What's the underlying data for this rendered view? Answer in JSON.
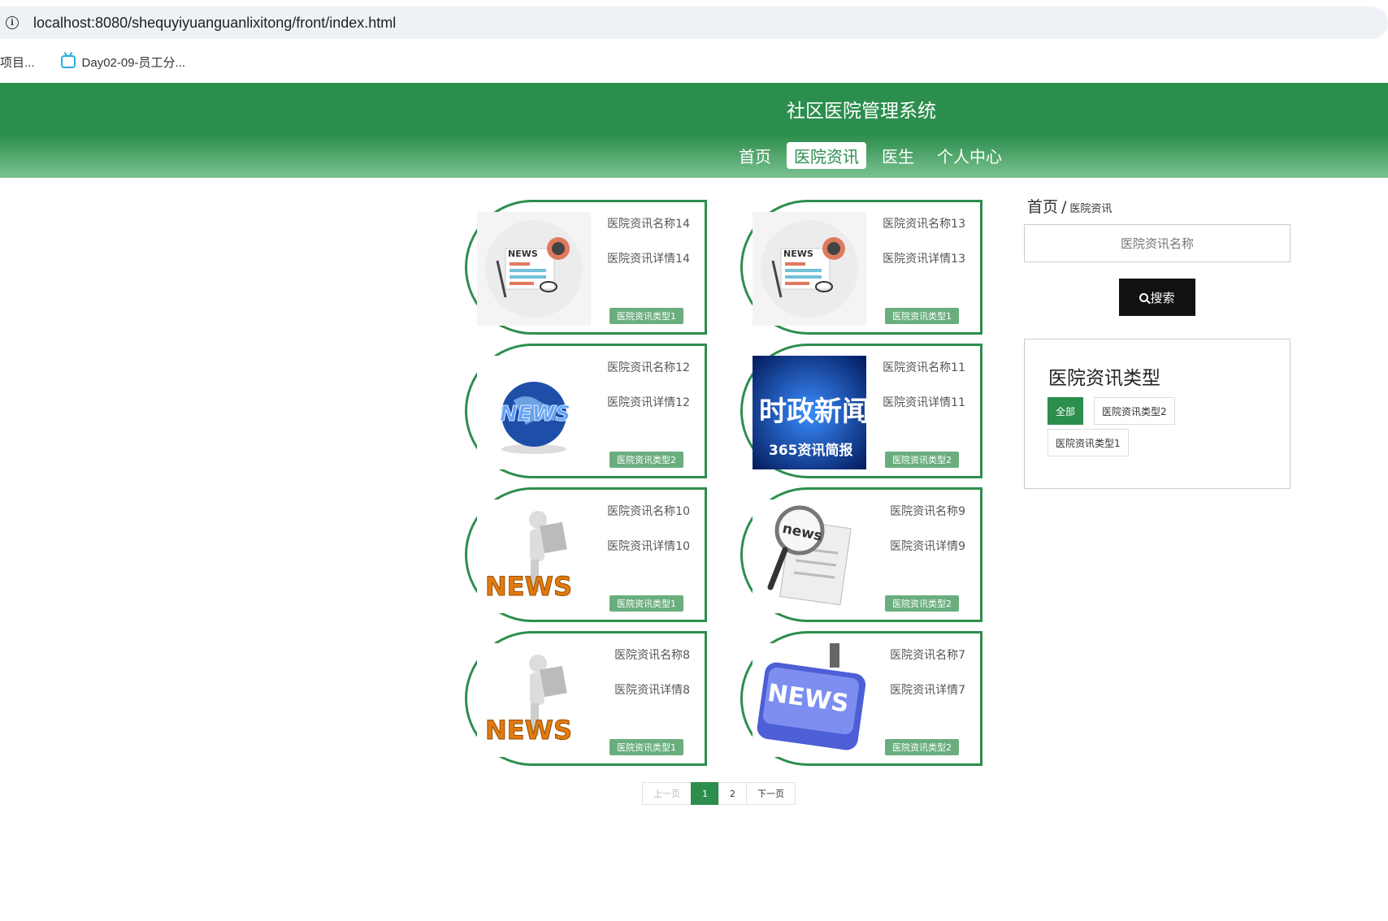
{
  "browser": {
    "url_host": "localhost",
    "url_rest": ":8080/shequyiyuanguanlixitong/front/index.html",
    "bookmarks": [
      {
        "label": "项目..."
      },
      {
        "label": "Day02-09-员工分..."
      }
    ]
  },
  "header": {
    "title": "社区医院管理系统",
    "nav": [
      {
        "label": "首页"
      },
      {
        "label": "医院资讯",
        "active": true
      },
      {
        "label": "医生"
      },
      {
        "label": "个人中心"
      }
    ]
  },
  "cards": [
    {
      "name": "医院资讯名称14",
      "detail": "医院资讯详情14",
      "type": "医院资讯类型1",
      "image": "news-paper-icon"
    },
    {
      "name": "医院资讯名称13",
      "detail": "医院资讯详情13",
      "type": "医院资讯类型1",
      "image": "news-paper-icon"
    },
    {
      "name": "医院资讯名称12",
      "detail": "医院资讯详情12",
      "type": "医院资讯类型2",
      "image": "news-globe-icon"
    },
    {
      "name": "医院资讯名称11",
      "detail": "医院资讯详情11",
      "type": "医院资讯类型2",
      "image": "political-news-banner"
    },
    {
      "name": "医院资讯名称10",
      "detail": "医院资讯详情10",
      "type": "医院资讯类型1",
      "image": "news-figure-reading"
    },
    {
      "name": "医院资讯名称9",
      "detail": "医院资讯详情9",
      "type": "医院资讯类型2",
      "image": "news-magnifier"
    },
    {
      "name": "医院资讯名称8",
      "detail": "医院资讯详情8",
      "type": "医院资讯类型1",
      "image": "news-figure-reading"
    },
    {
      "name": "医院资讯名称7",
      "detail": "医院资讯详情7",
      "type": "医院资讯类型2",
      "image": "news-keyboard-key"
    }
  ],
  "thumb_text": {
    "news": "NEWS",
    "news_lower": "news",
    "political_title": "时政新闻",
    "political_sub": "365资讯简报"
  },
  "pager": {
    "prev": "上一页",
    "pages": [
      "1",
      "2"
    ],
    "current": "1",
    "next": "下一页"
  },
  "sidebar": {
    "breadcrumb_home": "首页",
    "breadcrumb_sep": "/",
    "breadcrumb_current": "医院资讯",
    "search_placeholder": "医院资讯名称",
    "search_button": "搜索",
    "type_title": "医院资讯类型",
    "types": [
      {
        "label": "全部",
        "active": true
      },
      {
        "label": "医院资讯类型2"
      },
      {
        "label": "医院资讯类型1"
      }
    ]
  },
  "colors": {
    "brand_green": "#2c8e4c",
    "tag_green": "#6aae7e"
  }
}
